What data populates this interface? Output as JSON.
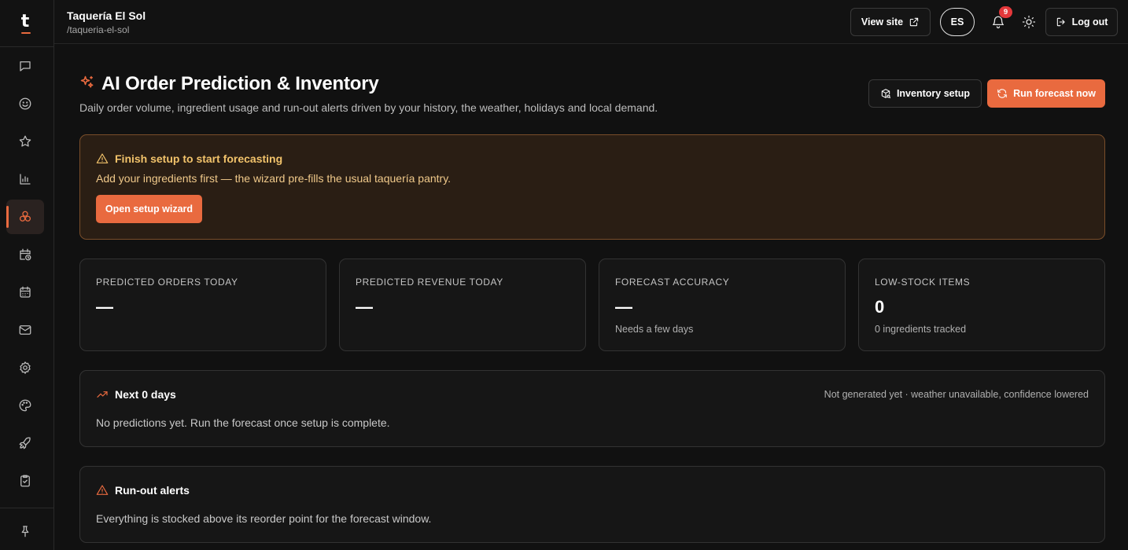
{
  "sidebar": {
    "logo": "t",
    "items": [
      {
        "name": "messages",
        "icon": "message-square-icon"
      },
      {
        "name": "smile",
        "icon": "smile-icon"
      },
      {
        "name": "reviews",
        "icon": "star-icon"
      },
      {
        "name": "analytics",
        "icon": "bar-chart-icon"
      },
      {
        "name": "ai-prediction",
        "icon": "cubes-icon",
        "active": true
      },
      {
        "name": "schedule",
        "icon": "calendar-clock-icon"
      },
      {
        "name": "calendar",
        "icon": "calendar-icon"
      },
      {
        "name": "mail",
        "icon": "mail-icon"
      },
      {
        "name": "settings",
        "icon": "gear-icon"
      },
      {
        "name": "appearance",
        "icon": "palette-icon"
      },
      {
        "name": "launch",
        "icon": "rocket-icon"
      },
      {
        "name": "checklist",
        "icon": "clipboard-check-icon"
      },
      {
        "name": "pin",
        "icon": "pin-icon"
      }
    ]
  },
  "header": {
    "restaurant_name": "Taquería El Sol",
    "slug": "/taqueria-el-sol",
    "view_site_label": "View site",
    "language": "ES",
    "notification_count": "9",
    "logout_label": "Log out"
  },
  "page": {
    "title": "AI Order Prediction & Inventory",
    "subtitle": "Daily order volume, ingredient usage and run-out alerts driven by your history, the weather, holidays and local demand.",
    "inventory_setup_label": "Inventory setup",
    "run_forecast_label": "Run forecast now"
  },
  "setup_alert": {
    "title": "Finish setup to start forecasting",
    "body": "Add your ingredients first — the wizard pre-fills the usual taquería pantry.",
    "button_label": "Open setup wizard"
  },
  "stats": [
    {
      "label": "PREDICTED ORDERS TODAY",
      "value": "—",
      "note": ""
    },
    {
      "label": "PREDICTED REVENUE TODAY",
      "value": "—",
      "note": ""
    },
    {
      "label": "FORECAST ACCURACY",
      "value": "—",
      "note": "Needs a few days"
    },
    {
      "label": "LOW-STOCK ITEMS",
      "value": "0",
      "note": "0 ingredients tracked"
    }
  ],
  "forecast_card": {
    "title": "Next 0 days",
    "meta": "Not generated yet · weather unavailable, confidence lowered",
    "body": "No predictions yet. Run the forecast once setup is complete."
  },
  "runout_card": {
    "title": "Run-out alerts",
    "body": "Everything is stocked above its reorder point for the forecast window."
  },
  "colors": {
    "accent": "#e96a3f",
    "background": "#111111",
    "card": "#161616",
    "warning_text": "#f2c36b",
    "badge": "#e5383b"
  }
}
